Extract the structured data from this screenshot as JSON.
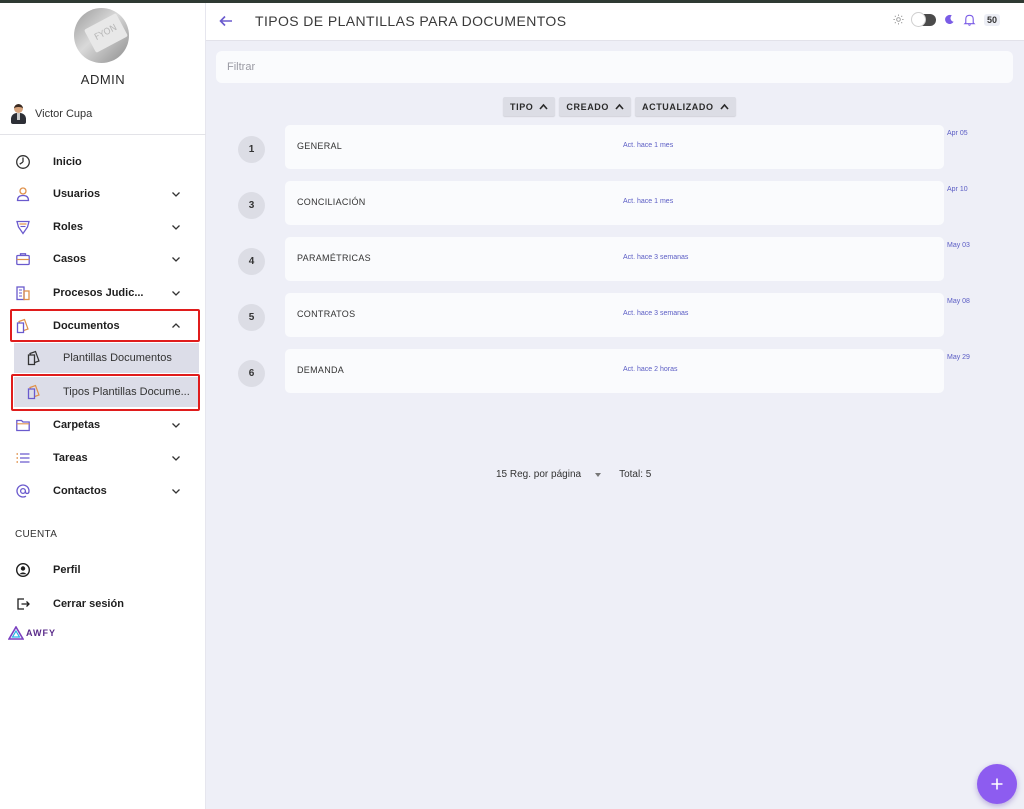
{
  "header": {
    "title": "TIPOS DE PLANTILLAS PARA DOCUMENTOS",
    "notifications": "50"
  },
  "sidebar": {
    "role": "ADMIN",
    "user_name": "Victor Cupa",
    "items": [
      {
        "label": "Inicio"
      },
      {
        "label": "Usuarios"
      },
      {
        "label": "Roles"
      },
      {
        "label": "Casos"
      },
      {
        "label": "Procesos Judic..."
      },
      {
        "label": "Documentos"
      },
      {
        "label": "Plantillas Documentos"
      },
      {
        "label": "Tipos Plantillas Docume..."
      },
      {
        "label": "Carpetas"
      },
      {
        "label": "Tareas"
      },
      {
        "label": "Contactos"
      }
    ],
    "section": "CUENTA",
    "account": [
      {
        "label": "Perfil"
      },
      {
        "label": "Cerrar sesión"
      }
    ],
    "logo": "AWFY"
  },
  "filter": {
    "placeholder": "Filtrar",
    "value": ""
  },
  "sort": [
    {
      "label": "TIPO"
    },
    {
      "label": "CREADO"
    },
    {
      "label": "ACTUALIZADO"
    }
  ],
  "rows": [
    {
      "num": "1",
      "name": "GENERAL",
      "updated": "Act. hace 1 mes",
      "date": "Apr 05"
    },
    {
      "num": "3",
      "name": "CONCILIACIÓN",
      "updated": "Act. hace 1 mes",
      "date": "Apr 10"
    },
    {
      "num": "4",
      "name": "PARAMÉTRICAS",
      "updated": "Act. hace 3 semanas",
      "date": "May 03"
    },
    {
      "num": "5",
      "name": "CONTRATOS",
      "updated": "Act. hace 3 semanas",
      "date": "May 08"
    },
    {
      "num": "6",
      "name": "DEMANDA",
      "updated": "Act. hace 2 horas",
      "date": "May 29"
    }
  ],
  "pagination": {
    "per_page": "15 Reg. por página",
    "total": "Total: 5"
  },
  "colors": {
    "accent": "#8d5cf0",
    "link": "#5a5cc4",
    "highlight": "#e01c1c",
    "background": "#eeeff7"
  }
}
